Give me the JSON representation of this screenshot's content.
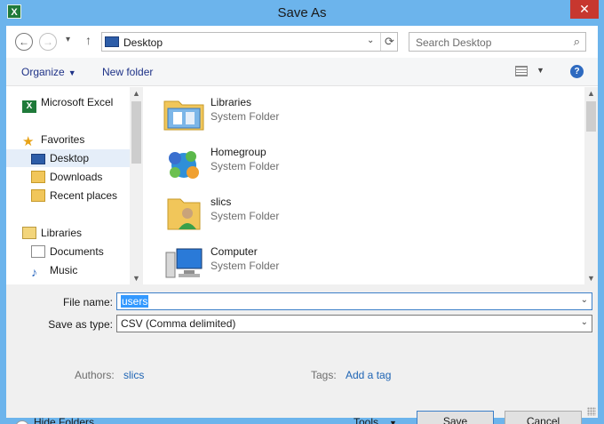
{
  "window": {
    "title": "Save As",
    "app_icon": "X",
    "close_glyph": "✕"
  },
  "nav": {
    "back_glyph": "←",
    "forward_glyph": "→",
    "recent_glyph": "▾",
    "up_glyph": "↑",
    "address": "Desktop",
    "address_dropdown_glyph": "⌄",
    "refresh_glyph": "⟳",
    "search_placeholder": "Search Desktop",
    "search_glyph": "⌕"
  },
  "toolbar": {
    "organize": "Organize",
    "organize_caret": "▼",
    "new_folder": "New folder",
    "view_caret": "▼",
    "help_glyph": "?"
  },
  "sidebar": {
    "scroll_up": "▲",
    "scroll_down": "▼",
    "items": [
      {
        "label": "Microsoft Excel",
        "icon": "excel-icon"
      },
      {
        "label": "Favorites",
        "icon": "star-icon"
      },
      {
        "label": "Desktop",
        "icon": "desktop-icon"
      },
      {
        "label": "Downloads",
        "icon": "downloads-icon"
      },
      {
        "label": "Recent places",
        "icon": "recent-places-icon"
      },
      {
        "label": "Libraries",
        "icon": "libraries-icon"
      },
      {
        "label": "Documents",
        "icon": "documents-icon"
      },
      {
        "label": "Music",
        "icon": "music-icon"
      }
    ],
    "selected": "Desktop"
  },
  "files": {
    "scroll_up": "▲",
    "scroll_down": "▼",
    "items": [
      {
        "name": "Libraries",
        "type": "System Folder",
        "icon": "libraries-folder-icon"
      },
      {
        "name": "Homegroup",
        "type": "System Folder",
        "icon": "homegroup-icon"
      },
      {
        "name": "slics",
        "type": "System Folder",
        "icon": "user-folder-icon"
      },
      {
        "name": "Computer",
        "type": "System Folder",
        "icon": "computer-icon"
      }
    ]
  },
  "form": {
    "file_name_label": "File name:",
    "file_name_value": "users",
    "save_type_label": "Save as type:",
    "save_type_value": "CSV (Comma delimited)",
    "dropdown_glyph": "⌄",
    "authors_label": "Authors:",
    "authors_value": "slics",
    "tags_label": "Tags:",
    "tags_value": "Add a tag"
  },
  "footer": {
    "hide_folders": "Hide Folders",
    "hide_glyph": "▲",
    "tools": "Tools",
    "tools_caret": "▼",
    "save": "Save",
    "cancel": "Cancel"
  },
  "colors": {
    "frame": "#6cb4ec",
    "close": "#c7372f",
    "link": "#1e64b4",
    "selection": "#3399ff"
  }
}
